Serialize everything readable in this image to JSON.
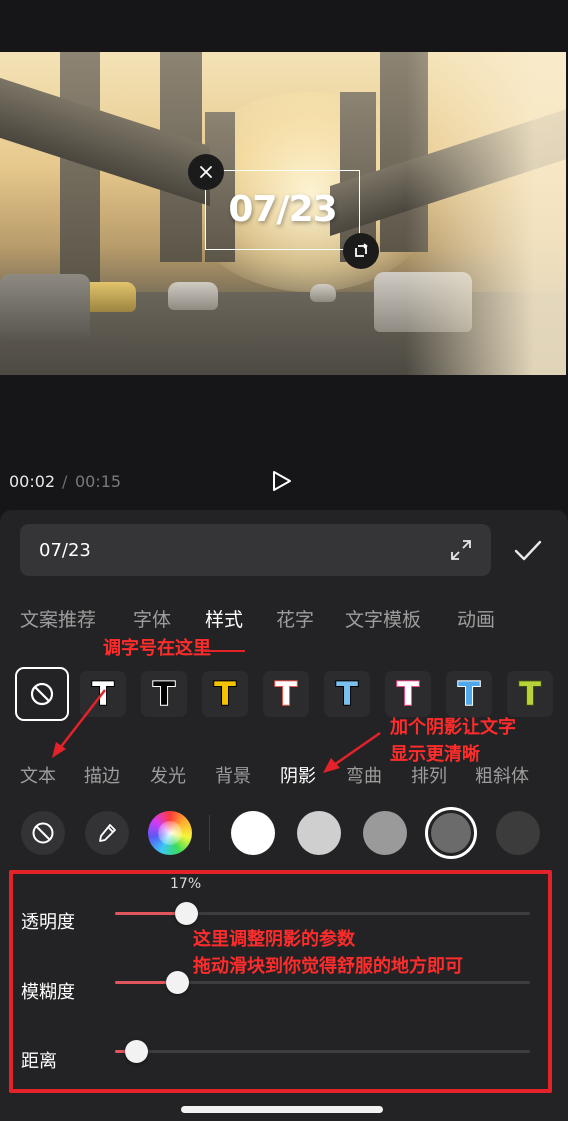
{
  "preview": {
    "overlay_text": "07/23",
    "delete_icon": "close-icon",
    "rotate_icon": "rotate-icon"
  },
  "player": {
    "current_time": "00:02",
    "separator": "/",
    "total_time": "00:15",
    "play_icon": "play-icon"
  },
  "editor": {
    "text_value": "07/23",
    "expand_icon": "expand-icon",
    "confirm_icon": "check-icon"
  },
  "tabs": [
    {
      "label": "文案推荐",
      "active": false
    },
    {
      "label": "字体",
      "active": false
    },
    {
      "label": "样式",
      "active": true
    },
    {
      "label": "花字",
      "active": false
    },
    {
      "label": "文字模板",
      "active": false
    },
    {
      "label": "动画",
      "active": false
    }
  ],
  "style_presets": {
    "none_icon": "no-style-icon",
    "glyph": "T",
    "items": [
      {
        "fill": "#ffffff",
        "stroke": "#000000"
      },
      {
        "fill": "#000000",
        "stroke": "#ffffff"
      },
      {
        "fill": "#f5c400",
        "stroke": "#000000"
      },
      {
        "fill": "#ffffff",
        "stroke": "#e85a4f"
      },
      {
        "fill": "#7bc1ef",
        "stroke": "#000000"
      },
      {
        "fill": "#ffffff",
        "stroke": "#ee4c8c"
      },
      {
        "fill": "#4fa8ec",
        "stroke": "#ffffff"
      },
      {
        "fill": "#b8d23a",
        "stroke": "#3a4a12"
      }
    ]
  },
  "subtabs": [
    {
      "label": "文本",
      "active": false
    },
    {
      "label": "描边",
      "active": false
    },
    {
      "label": "发光",
      "active": false
    },
    {
      "label": "背景",
      "active": false
    },
    {
      "label": "阴影",
      "active": true
    },
    {
      "label": "弯曲",
      "active": false
    },
    {
      "label": "排列",
      "active": false
    },
    {
      "label": "粗斜体",
      "active": false
    }
  ],
  "colors": {
    "none_icon": "no-color-icon",
    "picker_icon": "eyedropper-icon",
    "wheel_icon": "color-wheel-icon",
    "swatches": [
      "#ffffff",
      "#cfcfcf",
      "#9a9a9a",
      "#6b6b6b",
      "#3c3c3c"
    ],
    "selected_index": 3
  },
  "sliders": [
    {
      "label": "透明度",
      "value": 17,
      "value_label": "17%"
    },
    {
      "label": "模糊度",
      "value": 15
    },
    {
      "label": "距离",
      "value": 5
    }
  ],
  "annotations": {
    "font_size_hint": "调字号在这里",
    "shadow_hint": [
      "加个阴影让文字",
      "显示更清晰"
    ],
    "slider_hint": [
      "这里调整阴影的参数",
      "拖动滑块到你觉得舒服的地方即可"
    ],
    "accent_color": "#ff2c2c"
  }
}
